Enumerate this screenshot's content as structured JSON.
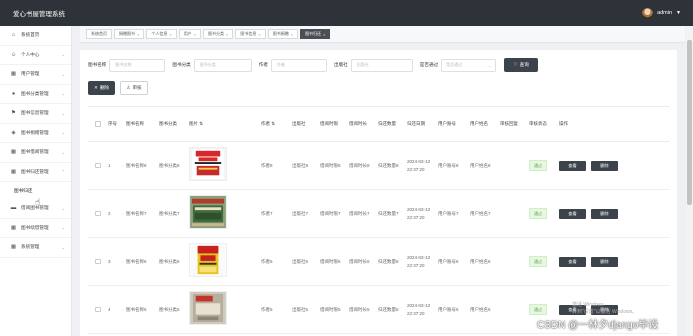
{
  "app": {
    "title": "爱心书屋管理系统",
    "user": "admin"
  },
  "sidebar": {
    "items": [
      {
        "label": "系统首页",
        "icon": "home-icon"
      },
      {
        "label": "个人中心",
        "icon": "user-icon"
      },
      {
        "label": "用户管理",
        "icon": "grid-icon"
      },
      {
        "label": "图书分类管理",
        "icon": "pin-icon"
      },
      {
        "label": "图书信息管理",
        "icon": "flag-icon"
      },
      {
        "label": "图书捐赠管理",
        "icon": "cube-icon"
      },
      {
        "label": "图书借阅管理",
        "icon": "grid-icon"
      },
      {
        "label": "图书归还管理",
        "icon": "grid-icon"
      }
    ],
    "sub_item": "图书归还",
    "items_after": [
      {
        "label": "借阅图书管理",
        "icon": "folder-icon"
      },
      {
        "label": "图书续借管理",
        "icon": "grid-icon"
      },
      {
        "label": "系统管理",
        "icon": "grid-icon"
      }
    ]
  },
  "tabs": [
    {
      "label": "系统首页",
      "active": false
    },
    {
      "label": "捐赠图书",
      "active": false
    },
    {
      "label": "个人信息",
      "active": false
    },
    {
      "label": "用户",
      "active": false
    },
    {
      "label": "图书分类",
      "active": false
    },
    {
      "label": "图书信息",
      "active": false
    },
    {
      "label": "图书捐赠",
      "active": false
    },
    {
      "label": "图书归还",
      "active": true
    }
  ],
  "search": {
    "name_label": "图书名称",
    "name_placeholder": "图书名称",
    "cat_label": "图书分类",
    "cat_placeholder": "图书分类",
    "author_label": "作者",
    "author_placeholder": "作者",
    "pub_label": "出版社",
    "pub_placeholder": "出版社",
    "audit_label": "是否通过",
    "audit_placeholder": "是否通过",
    "query_button": "查询"
  },
  "actions": {
    "delete": "删除",
    "audit": "审核"
  },
  "table": {
    "headers": [
      "序号",
      "图书名称",
      "图书分类",
      "图片",
      "作者",
      "出版社",
      "借阅时限",
      "借阅时长",
      "归还数量",
      "归还日期",
      "用户账号",
      "用户姓名",
      "审核回复",
      "审核状态",
      "操作"
    ],
    "view_label": "查看",
    "delete_label": "删除",
    "rows": [
      {
        "idx": "1",
        "name": "图书名称8",
        "cat": "图书分类8",
        "author": "作者8",
        "pub": "出版社8",
        "borrow": "借阅时限8",
        "unit": "借阅时长8",
        "qty": "归还数量8",
        "date": "2024-03-13 22:37:20",
        "uno": "用户账号8",
        "uname": "用户姓名8",
        "reply": "",
        "status": "通过"
      },
      {
        "idx": "2",
        "name": "图书名称7",
        "cat": "图书分类7",
        "author": "作者7",
        "pub": "出版社7",
        "borrow": "借阅时限7",
        "unit": "借阅时长7",
        "qty": "归还数量7",
        "date": "2024-03-13 22:37:20",
        "uno": "用户账号7",
        "uname": "用户姓名7",
        "reply": "",
        "status": "通过"
      },
      {
        "idx": "3",
        "name": "图书名称6",
        "cat": "图书分类6",
        "author": "作者6",
        "pub": "出版社6",
        "borrow": "借阅时限6",
        "unit": "借阅时长6",
        "qty": "归还数量6",
        "date": "2024-03-13 22:37:20",
        "uno": "用户账号6",
        "uname": "用户姓名6",
        "reply": "",
        "status": "通过"
      },
      {
        "idx": "4",
        "name": "图书名称5",
        "cat": "图书分类5",
        "author": "作者5",
        "pub": "出版社5",
        "borrow": "借阅时限5",
        "unit": "借阅时长5",
        "qty": "归还数量5",
        "date": "2024-03-13 22:37:20",
        "uno": "用户账号5",
        "uname": "用户姓名5",
        "reply": "",
        "status": "通过"
      }
    ]
  },
  "watermark": {
    "os": "激活 Windows\n转到\"设置\"以激活 Windows。",
    "text": "CSDN @一林夕django毕设"
  },
  "colors": {
    "topbar": "#2d3338",
    "button": "#3d434a",
    "pass_badge": "#58a53a"
  }
}
